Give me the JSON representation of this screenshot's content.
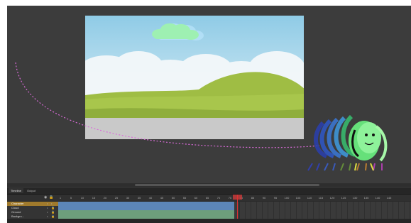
{
  "app": {
    "name": "Flash animation workspace"
  },
  "colors": {
    "pasteboard": "#3c3c3c",
    "sky_top": "#9fd3ea",
    "sky_bottom": "#e6f2f7",
    "hill_green": "#8fb23d",
    "ground_gray": "#c8c8c8",
    "motion_path": "#d96bd8",
    "timeline_bg": "#2b2b2b",
    "selected_layer": "#a07a2c",
    "tween_blue": "#5c86b8",
    "tween_green": "#6d9e7c",
    "playhead": "#e03030"
  },
  "timeline": {
    "tabs": [
      {
        "label": "Timeline"
      },
      {
        "label": "Output"
      }
    ],
    "header_icons": [
      "eye-icon",
      "lock-icon"
    ],
    "ruler": [
      "1",
      "5",
      "10",
      "15",
      "20",
      "25",
      "30",
      "35",
      "40",
      "45",
      "50",
      "55",
      "60",
      "65",
      "70",
      "75",
      "80",
      "85",
      "90",
      "95",
      "100",
      "105",
      "110",
      "115",
      "120",
      "125",
      "130",
      "135",
      "140",
      "145"
    ],
    "layers": [
      {
        "name": "Character",
        "selected": true
      },
      {
        "name": "Cloud",
        "selected": false
      },
      {
        "name": "Ground",
        "selected": false
      },
      {
        "name": "Backgro...",
        "selected": false
      }
    ]
  }
}
